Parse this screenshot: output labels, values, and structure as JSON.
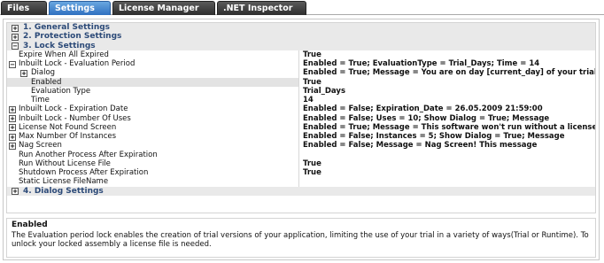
{
  "tabs": [
    {
      "label": "Files"
    },
    {
      "label": "Settings"
    },
    {
      "label": "License Manager"
    },
    {
      "label": ".NET Inspector"
    }
  ],
  "grid": {
    "categories": {
      "general": "1. General Settings",
      "protection": "2. Protection Settings",
      "lock": "3. Lock Settings",
      "dialog": "4. Dialog Settings"
    },
    "expand_plus": "+",
    "expand_minus": "−",
    "props": {
      "expire_all": {
        "name": "Expire When All Expired",
        "value": "True"
      },
      "eval_period": {
        "name": "Inbuilt Lock - Evaluation Period",
        "value": "Enabled = True; EvaluationType = Trial_Days; Time = 14"
      },
      "dialog": {
        "name": "Dialog",
        "value": "Enabled = True; Message = You are on day [current_day] of your trial"
      },
      "enabled": {
        "name": "Enabled",
        "value": "True"
      },
      "eval_type": {
        "name": "Evaluation Type",
        "value": "Trial_Days"
      },
      "time": {
        "name": "Time",
        "value": "14"
      },
      "exp_date": {
        "name": "Inbuilt Lock - Expiration Date",
        "value": "Enabled = False; Expiration_Date = 26.05.2009 21:59:00"
      },
      "num_uses": {
        "name": "Inbuilt Lock - Number Of Uses",
        "value": "Enabled = False; Uses = 10; Show Dialog = True; Message"
      },
      "lic_not_found": {
        "name": "License Not Found Screen",
        "value": "Enabled = True; Message = This software won't run without a license"
      },
      "max_instances": {
        "name": "Max Number Of Instances",
        "value": "Enabled = False; Instances = 5; Show Dialog = True; Message"
      },
      "nag_screen": {
        "name": "Nag Screen",
        "value": "Enabled = False; Message = Nag Screen! This message"
      },
      "run_another": {
        "name": "Run Another Process After Expiration",
        "value": ""
      },
      "run_without": {
        "name": "Run Without License File",
        "value": "True"
      },
      "shutdown": {
        "name": "Shutdown Process After Expiration",
        "value": "True"
      },
      "static_lic": {
        "name": "Static License FileName",
        "value": ""
      }
    }
  },
  "description": {
    "title": "Enabled",
    "text": "The Evaluation period lock enables the creation of trial versions of your application, limiting the use of your trial in a variety of ways(Trial or Runtime). To unlock your locked assembly a license file is needed."
  }
}
